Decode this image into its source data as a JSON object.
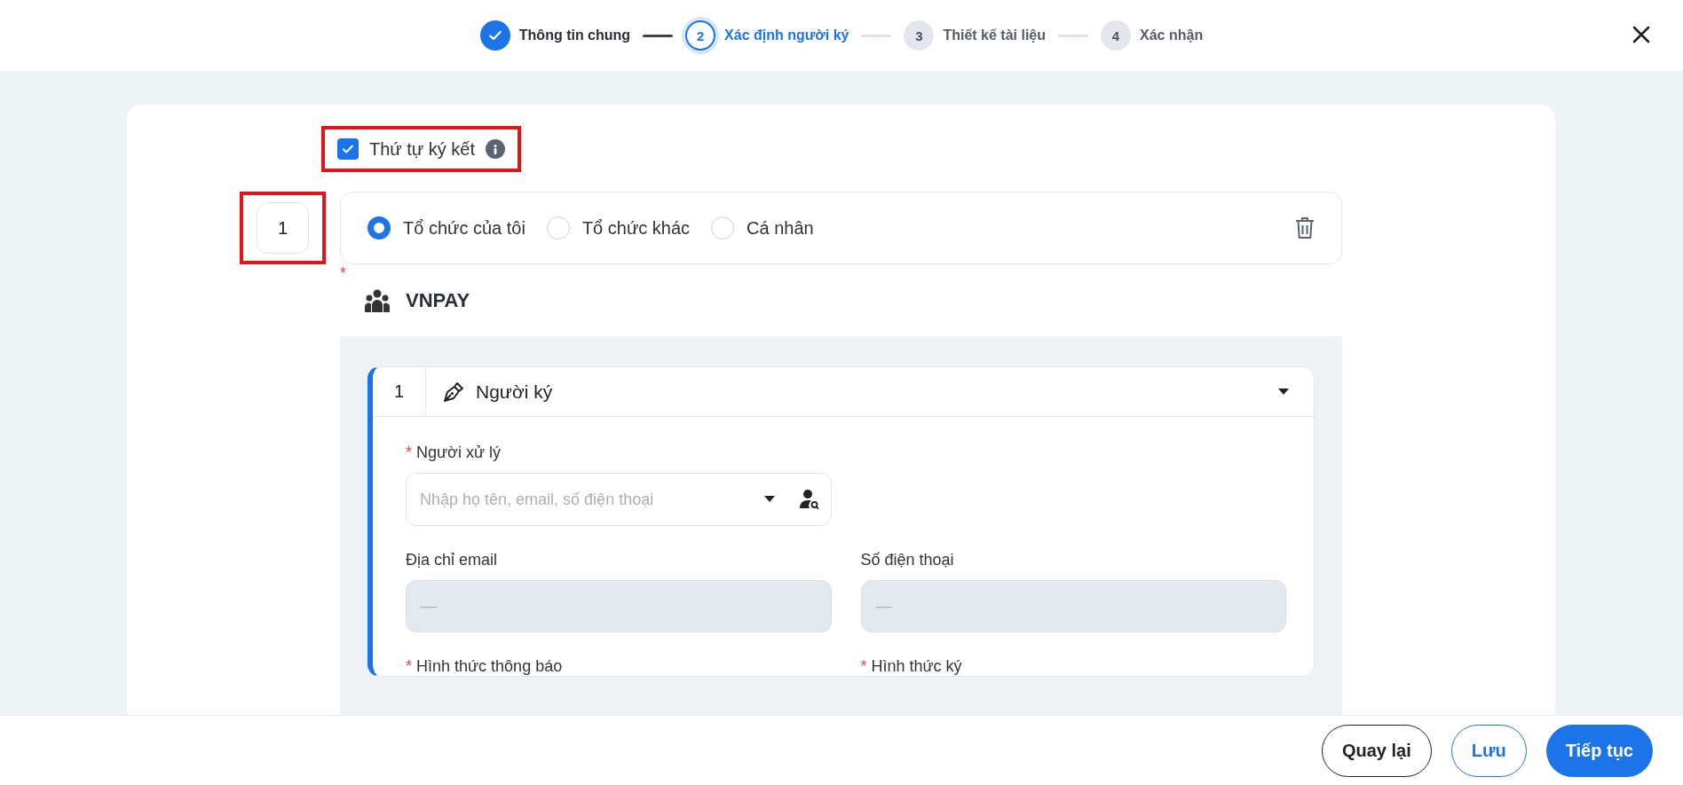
{
  "stepper": {
    "steps": [
      {
        "label": "Thông tin chung",
        "completed": true,
        "selected": false
      },
      {
        "number": "2",
        "label": "Xác định người ký",
        "completed": false,
        "selected": true
      },
      {
        "number": "3",
        "label": "Thiết kế tài liệu",
        "completed": false,
        "selected": false
      },
      {
        "number": "4",
        "label": "Xác nhận",
        "completed": false,
        "selected": false
      }
    ]
  },
  "signing_order": {
    "label": "Thứ tự ký kết",
    "checked": true,
    "highlighted": true
  },
  "parties": [
    {
      "order": "1",
      "highlighted": true,
      "types": [
        {
          "label": "Tổ chức của tôi",
          "selected": true
        },
        {
          "label": "Tổ chức khác",
          "selected": false
        },
        {
          "label": "Cá nhân",
          "selected": false
        }
      ],
      "organization": {
        "name": "VNPAY",
        "required_mark": "*"
      },
      "signers": [
        {
          "order": "1",
          "role": "Người ký",
          "expanded": true,
          "fields": [
            {
              "kind": "search_select",
              "required_mark": "*",
              "label": "Người xử lý",
              "placeholder": "Nhập họ tên, email, số điện thoại"
            },
            {
              "kind": "readonly",
              "label": "Địa chỉ email",
              "value": "—"
            },
            {
              "kind": "readonly",
              "label": "Số điện thoại",
              "value": "—"
            },
            {
              "kind": "label",
              "required_mark": "*",
              "label": "Hình thức thông báo"
            },
            {
              "kind": "label",
              "required_mark": "*",
              "label": "Hình thức ký"
            }
          ]
        }
      ]
    }
  ],
  "footer": {
    "buttons": [
      {
        "label": "Quay lại",
        "kind": "outline"
      },
      {
        "label": "Lưu",
        "kind": "primary_outline"
      },
      {
        "label": "Tiếp tục",
        "kind": "primary"
      }
    ]
  }
}
